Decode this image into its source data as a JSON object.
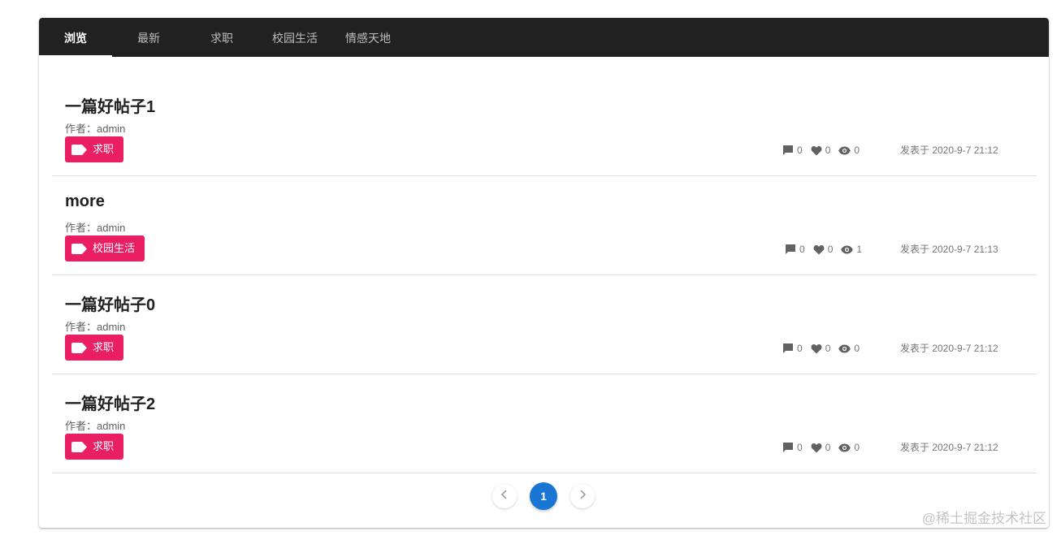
{
  "tabs": [
    {
      "label": "浏览",
      "active": true
    },
    {
      "label": "最新",
      "active": false
    },
    {
      "label": "求职",
      "active": false
    },
    {
      "label": "校园生活",
      "active": false
    },
    {
      "label": "情感天地",
      "active": false
    }
  ],
  "posts": [
    {
      "title": "一篇好帖子1",
      "author": "作者：admin",
      "tag": "求职",
      "comments": "0",
      "likes": "0",
      "views": "0",
      "posted": "发表于 2020-9-7 21:12"
    },
    {
      "title": "more",
      "author": "作者：admin",
      "tag": "校园生活",
      "comments": "0",
      "likes": "0",
      "views": "1",
      "posted": "发表于 2020-9-7 21:13"
    },
    {
      "title": "一篇好帖子0",
      "author": "作者：admin",
      "tag": "求职",
      "comments": "0",
      "likes": "0",
      "views": "0",
      "posted": "发表于 2020-9-7 21:12"
    },
    {
      "title": "一篇好帖子2",
      "author": "作者：admin",
      "tag": "求职",
      "comments": "0",
      "likes": "0",
      "views": "0",
      "posted": "发表于 2020-9-7 21:12"
    }
  ],
  "pagination": {
    "current_page": "1",
    "prev_icon": "chevron-left-icon",
    "next_icon": "chevron-right-icon"
  },
  "icons": {
    "tag": "label-icon",
    "comments": "comment-icon",
    "likes": "heart-icon",
    "views": "eye-icon"
  },
  "watermark": "@稀土掘金技术社区",
  "colors": {
    "tabbar_bg": "#212121",
    "tag_bg": "#e91e63",
    "page_active": "#1976d2"
  }
}
